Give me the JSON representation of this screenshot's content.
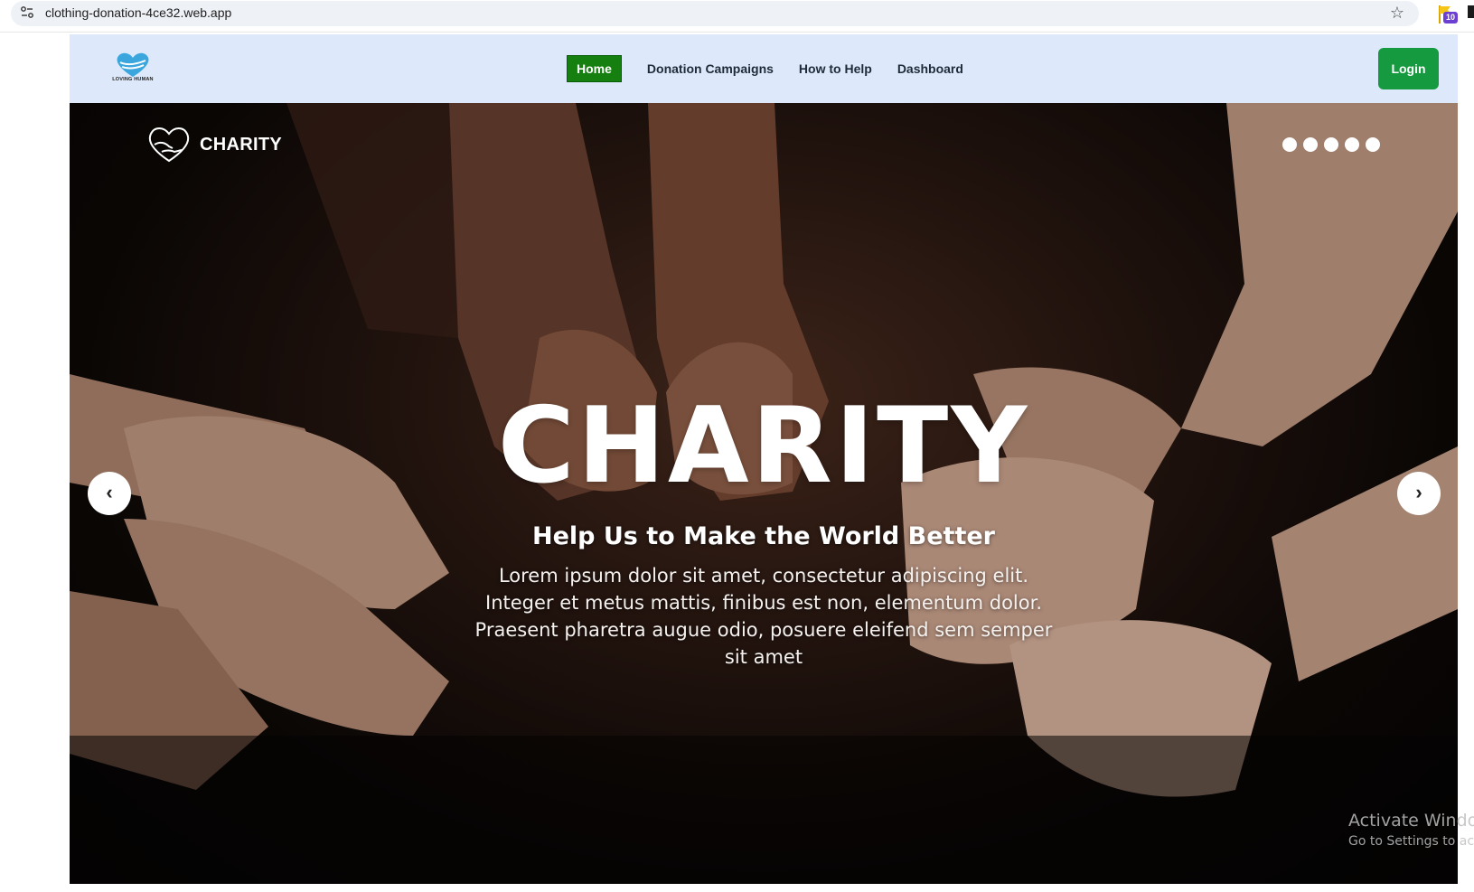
{
  "browser": {
    "url": "clothing-donation-4ce32.web.app",
    "extension_badge": "10"
  },
  "navbar": {
    "logo_text": "LOVING HUMAN",
    "links": [
      {
        "label": "Home",
        "active": true
      },
      {
        "label": "Donation Campaigns",
        "active": false
      },
      {
        "label": "How to Help",
        "active": false
      },
      {
        "label": "Dashboard",
        "active": false
      }
    ],
    "login_label": "Login"
  },
  "hero": {
    "brand": "CHARITY",
    "title": "CHARITY",
    "subtitle": "Help Us to Make the World Better",
    "body": "Lorem ipsum dolor sit amet, consectetur adipiscing elit. Integer et metus mattis, finibus est non, elementum dolor. Praesent pharetra augue odio, posuere eleifend sem semper sit amet",
    "slide_count": 5,
    "prev_icon": "chevron-left-icon",
    "next_icon": "chevron-right-icon"
  },
  "watermark": {
    "title": "Activate Windows",
    "subtitle": "Go to Settings to activate Windows."
  },
  "colors": {
    "navbar_bg": "#dde9fb",
    "home_active": "#15800f",
    "login_bg": "#169a3f"
  }
}
